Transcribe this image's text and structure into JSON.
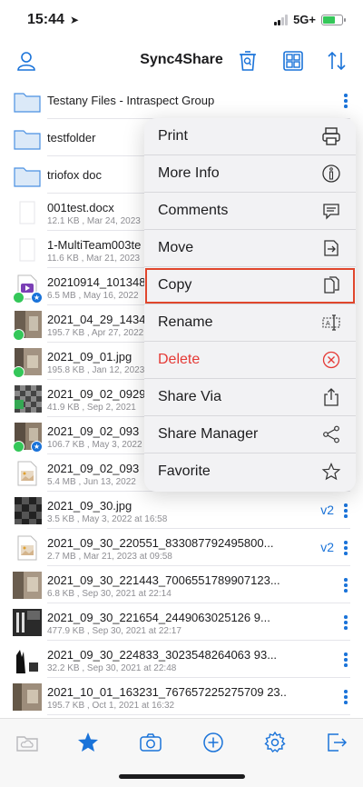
{
  "status": {
    "time": "15:44",
    "network": "5G+"
  },
  "nav": {
    "title": "Sync4Share"
  },
  "files": [
    {
      "name": "Testany Files - Intraspect Group",
      "meta": "",
      "type": "folder"
    },
    {
      "name": "testfolder",
      "meta": "",
      "type": "folder"
    },
    {
      "name": "triofox doc",
      "meta": "",
      "type": "folder"
    },
    {
      "name": "001test.docx",
      "meta": "12.1 KB , Mar 24, 2023",
      "type": "doc"
    },
    {
      "name": "1-MultiTeam003te",
      "meta": "11.6 KB , Mar 21, 2023",
      "type": "doc"
    },
    {
      "name": "20210914_101348",
      "meta": "6.5 MB , May 16, 2022",
      "type": "video"
    },
    {
      "name": "2021_04_29_1434",
      "meta": "195.7 KB , Apr 27, 2022",
      "type": "photo"
    },
    {
      "name": "2021_09_01.jpg",
      "meta": "195.8 KB , Jan 12, 2023",
      "type": "photo"
    },
    {
      "name": "2021_09_02_0929",
      "meta": "41.9 KB , Sep 2, 2021",
      "type": "checker"
    },
    {
      "name": "2021_09_02_093",
      "meta": "106.7 KB , May 3, 2022",
      "type": "photo"
    },
    {
      "name": "2021_09_02_093",
      "meta": "5.4 MB , Jun 13, 2022",
      "type": "image"
    },
    {
      "name": "2021_09_30.jpg",
      "meta": "3.5 KB , May 3, 2022 at 16:58",
      "type": "checker-dark",
      "version": "v2"
    },
    {
      "name": "2021_09_30_220551_833087792495800...",
      "meta": "2.7 MB , Mar 21, 2023 at 09:58",
      "type": "image",
      "version": "v2"
    },
    {
      "name": "2021_09_30_221443_7006551789907123...",
      "meta": "6.8 KB , Sep 30, 2021 at 22:14",
      "type": "photo"
    },
    {
      "name": "2021_09_30_221654_2449063025126 9...",
      "meta": "477.9 KB , Sep 30, 2021 at 22:17",
      "type": "dark"
    },
    {
      "name": "2021_09_30_224833_3023548264063 93...",
      "meta": "32.2 KB , Sep 30, 2021 at 22:48",
      "type": "bw"
    },
    {
      "name": "2021_10_01_163231_767657225275709 23...",
      "meta": "195.7 KB , Oct 1, 2021 at 16:32",
      "type": "photo"
    }
  ],
  "menu": {
    "items": [
      {
        "label": "Print",
        "icon": "printer-icon"
      },
      {
        "label": "More Info",
        "icon": "info-icon"
      },
      {
        "label": "Comments",
        "icon": "comment-icon"
      },
      {
        "label": "Move",
        "icon": "move-icon"
      },
      {
        "label": "Copy",
        "icon": "copy-icon"
      },
      {
        "label": "Rename",
        "icon": "rename-icon"
      },
      {
        "label": "Delete",
        "icon": "delete-icon"
      },
      {
        "label": "Share Via",
        "icon": "share-icon"
      },
      {
        "label": "Share Manager",
        "icon": "share-manager-icon"
      },
      {
        "label": "Favorite",
        "icon": "star-icon"
      }
    ],
    "highlighted": "Copy"
  },
  "colors": {
    "accent": "#1a73d9",
    "danger": "#e53935",
    "highlight": "#e0462c",
    "success": "#34c759"
  }
}
